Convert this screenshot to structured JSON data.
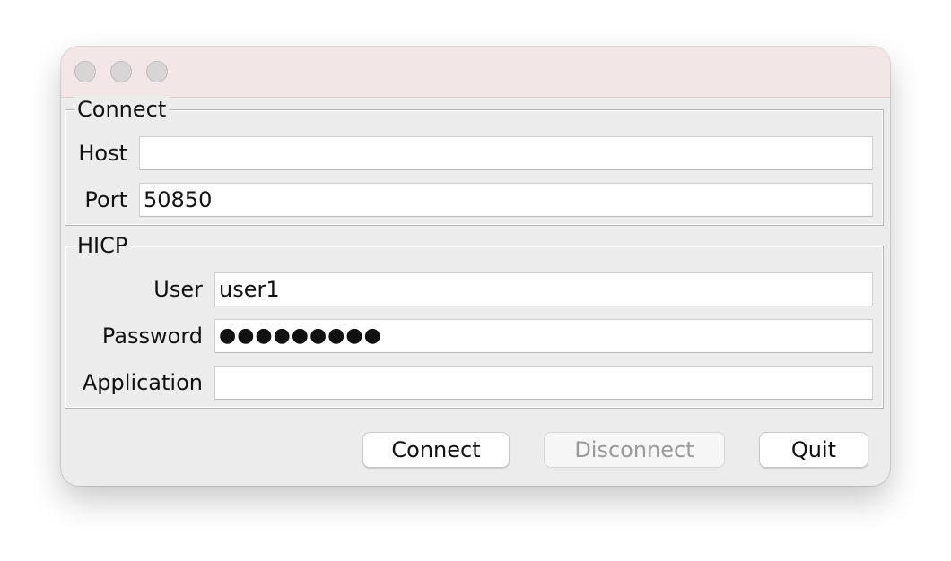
{
  "window": {
    "title": ""
  },
  "connect_group": {
    "title": "Connect",
    "host_label": "Host",
    "host_value": "",
    "port_label": "Port",
    "port_value": "50850"
  },
  "hicp_group": {
    "title": "HICP",
    "user_label": "User",
    "user_value": "user1",
    "password_label": "Password",
    "password_value": "●●●●●●●●●",
    "application_label": "Application",
    "application_value": ""
  },
  "buttons": {
    "connect_label": "Connect",
    "disconnect_label": "Disconnect",
    "quit_label": "Quit",
    "disconnect_enabled": false
  },
  "colors": {
    "titlebar": "#f2e6e7",
    "window_bg": "#ececec",
    "disabled_text": "#9a9a9a"
  }
}
